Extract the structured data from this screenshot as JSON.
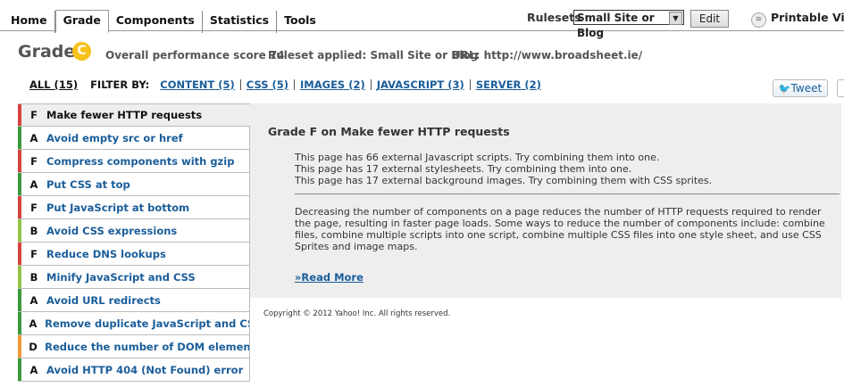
{
  "nav": {
    "tabs": [
      "Home",
      "Grade",
      "Components",
      "Statistics",
      "Tools"
    ],
    "active_tab": "Grade",
    "rulesets_label": "Rulesets",
    "ruleset_value": "Small Site or Blog",
    "edit_label": "Edit",
    "printable_label": "Printable View"
  },
  "header": {
    "title": "Grade",
    "grade": "C",
    "grade_color": "#f7c21a",
    "score_text": "Overall performance score 74",
    "ruleset_text": "Ruleset applied: Small Site or Blog",
    "url_text": "URL: http://www.broadsheet.ie/"
  },
  "filter": {
    "all_label": "ALL (15)",
    "filter_by_label": "FILTER BY:",
    "items": [
      "CONTENT (5)",
      "CSS (5)",
      "IMAGES (2)",
      "JAVASCRIPT (3)",
      "SERVER (2)"
    ]
  },
  "tweet_label": "Tweet",
  "rules": [
    {
      "grade": "F",
      "name": "Make fewer HTTP requests",
      "color": "#d9413d",
      "selected": true
    },
    {
      "grade": "A",
      "name": "Avoid empty src or href",
      "color": "#3a9a3a"
    },
    {
      "grade": "F",
      "name": "Compress components with gzip",
      "color": "#d9413d"
    },
    {
      "grade": "A",
      "name": "Put CSS at top",
      "color": "#3a9a3a"
    },
    {
      "grade": "F",
      "name": "Put JavaScript at bottom",
      "color": "#d9413d"
    },
    {
      "grade": "B",
      "name": "Avoid CSS expressions",
      "color": "#95c347"
    },
    {
      "grade": "F",
      "name": "Reduce DNS lookups",
      "color": "#d9413d"
    },
    {
      "grade": "B",
      "name": "Minify JavaScript and CSS",
      "color": "#95c347"
    },
    {
      "grade": "A",
      "name": "Avoid URL redirects",
      "color": "#3a9a3a"
    },
    {
      "grade": "A",
      "name": "Remove duplicate JavaScript and CSS",
      "color": "#3a9a3a"
    },
    {
      "grade": "D",
      "name": "Reduce the number of DOM elements",
      "color": "#f0983a"
    },
    {
      "grade": "A",
      "name": "Avoid HTTP 404 (Not Found) error",
      "color": "#3a9a3a"
    }
  ],
  "detail": {
    "heading": "Grade F on Make fewer HTTP requests",
    "findings": [
      "This page has 66 external Javascript scripts. Try combining them into one.",
      "This page has 17 external stylesheets. Try combining them into one.",
      "This page has 17 external background images. Try combining them with CSS sprites."
    ],
    "description": "Decreasing the number of components on a page reduces the number of HTTP requests required to render the page, resulting in faster page loads. Some ways to reduce the number of components include: combine files, combine multiple scripts into one script, combine multiple CSS files into one style sheet, and use CSS Sprites and image maps.",
    "read_more": "»Read More"
  },
  "copyright": "Copyright © 2012 Yahoo! Inc. All rights reserved."
}
